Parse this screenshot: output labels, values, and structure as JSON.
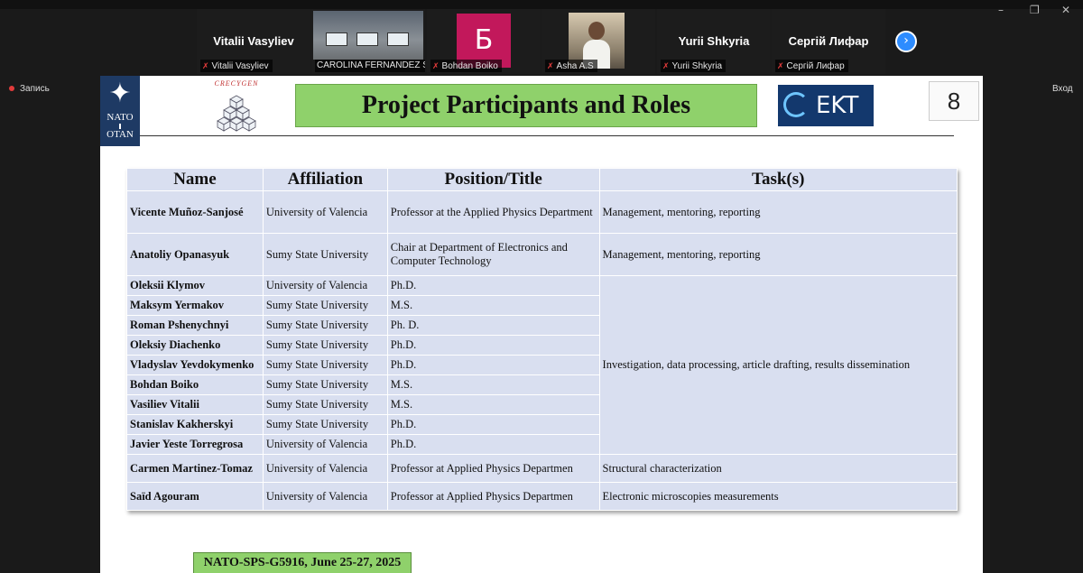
{
  "window": {
    "minimize": "–",
    "restore": "❐",
    "close": "✕"
  },
  "recording_label": "Запись",
  "login_label": "Вход",
  "participants_strip": [
    {
      "display_name": "Vitalii Vasyliev",
      "footer": "Vitalii Vasyliev"
    },
    {
      "display_name": "",
      "footer": "CAROLINA FERNANDEZ S..."
    },
    {
      "display_name": "Б",
      "footer": "Bohdan Boiko"
    },
    {
      "display_name": "",
      "footer": "Asha A.S"
    },
    {
      "display_name": "Yurii Shkyria",
      "footer": "Yurii Shkyria"
    },
    {
      "display_name": "Сергій Лифар",
      "footer": "Сергій Лифар"
    }
  ],
  "slide": {
    "nato_logo": {
      "line1": "NATO",
      "line2": "OTAN"
    },
    "crecy_logo": "CRECYGEN",
    "title": "Project Participants and Roles",
    "ekt_logo": "EKT",
    "page_number": "8",
    "table": {
      "headers": [
        "Name",
        "Affiliation",
        "Position/Title",
        "Task(s)"
      ],
      "rows": [
        {
          "name": "Vicente Muñoz-Sanjosé",
          "affiliation": "University of Valencia",
          "position": "Professor at the Applied Physics Department",
          "task": "Management, mentoring, reporting"
        },
        {
          "name": "Anatoliy Opanasyuk",
          "affiliation": "Sumy State University",
          "position": "Chair at Department of Electronics and Computer Technology",
          "task": "Management, mentoring, reporting"
        },
        {
          "name": "Oleksii Klymov",
          "affiliation": "University of Valencia",
          "position": "Ph.D."
        },
        {
          "name": "Maksym Yermakov",
          "affiliation": "Sumy State University",
          "position": "M.S."
        },
        {
          "name": "Roman Pshenychnyi",
          "affiliation": "Sumy State University",
          "position": "Ph. D."
        },
        {
          "name": "Oleksiy Diachenko",
          "affiliation": "Sumy State University",
          "position": "Ph.D."
        },
        {
          "name": "Vladyslav Yevdokymenko",
          "affiliation": "Sumy State University",
          "position": "Ph.D."
        },
        {
          "name": "Bohdan Boiko",
          "affiliation": "Sumy State University",
          "position": "M.S."
        },
        {
          "name": "Vasiliev Vitalii",
          "affiliation": "Sumy State University",
          "position": "M.S."
        },
        {
          "name": "Stanislav Kakherskyi",
          "affiliation": "Sumy State University",
          "position": "Ph.D."
        },
        {
          "name": "Javier Yeste Torregrosa",
          "affiliation": "University of Valencia",
          "position": "Ph.D."
        },
        {
          "name": "Carmen Martinez-Tomaz",
          "affiliation": "University of Valencia",
          "position": "Professor at Applied Physics Departmen",
          "task": "Structural characterization"
        },
        {
          "name": "Saïd Agouram",
          "affiliation": "University of Valencia",
          "position": "Professor at Applied Physics Departmen",
          "task": "Electronic microscopies measurements"
        }
      ],
      "merged_task": "Investigation, data processing, article drafting, results dissemination"
    },
    "footer": "NATO-SPS-G5916, June 25-27, 2025"
  }
}
